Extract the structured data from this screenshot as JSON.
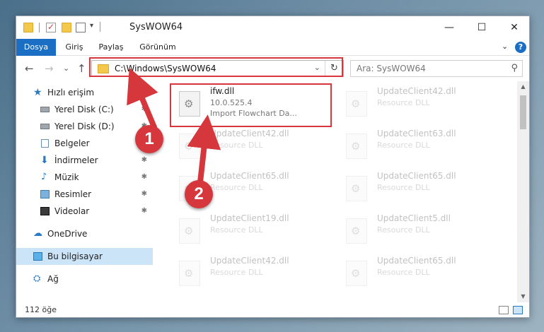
{
  "window": {
    "title": "SysWOW64",
    "minimize_glyph": "—",
    "maximize_glyph": "☐",
    "close_glyph": "✕"
  },
  "ribbon": {
    "tabs": [
      "Dosya",
      "Giriş",
      "Paylaş",
      "Görünüm"
    ],
    "expand_glyph": "⌄",
    "help_glyph": "?"
  },
  "nav": {
    "back_glyph": "←",
    "forward_glyph": "→",
    "recent_glyph": "⌄",
    "up_glyph": "↑",
    "address": "C:\\Windows\\SysWOW64",
    "refresh_glyph": "↻",
    "search_placeholder": "Ara: SysWOW64",
    "search_icon_glyph": "⚲"
  },
  "sidebar": {
    "items": [
      {
        "label": "Hızlı erişim",
        "icon": "star-icon",
        "glyph": "★",
        "pinned": false
      },
      {
        "label": "Yerel Disk (C:)",
        "icon": "disk-icon",
        "glyph": "",
        "pinned": true
      },
      {
        "label": "Yerel Disk (D:)",
        "icon": "disk-icon",
        "glyph": "",
        "pinned": true
      },
      {
        "label": "Belgeler",
        "icon": "documents-icon",
        "glyph": "",
        "pinned": true
      },
      {
        "label": "İndirmeler",
        "icon": "download-icon",
        "glyph": "⬇",
        "pinned": true
      },
      {
        "label": "Müzik",
        "icon": "music-icon",
        "glyph": "♪",
        "pinned": true
      },
      {
        "label": "Resimler",
        "icon": "pictures-icon",
        "glyph": "",
        "pinned": true
      },
      {
        "label": "Videolar",
        "icon": "videos-icon",
        "glyph": "",
        "pinned": true
      },
      {
        "label": "OneDrive",
        "icon": "onedrive-icon",
        "glyph": "☁",
        "pinned": false
      },
      {
        "label": "Bu bilgisayar",
        "icon": "this-pc-icon",
        "glyph": "",
        "pinned": false
      },
      {
        "label": "Ağ",
        "icon": "network-icon",
        "glyph": "⛭",
        "pinned": false
      }
    ],
    "pin_glyph": "✱"
  },
  "files": [
    {
      "name": "ifw.dll",
      "version": "10.0.525.4",
      "desc": "Import Flowchart Da..."
    },
    {
      "name": "UpdateClient42.dll",
      "version": "Resource DLL",
      "desc": ""
    },
    {
      "name": "UpdateClient42.dll",
      "version": "Resource DLL",
      "desc": ""
    },
    {
      "name": "UpdateClient63.dll",
      "version": "Resource DLL",
      "desc": ""
    },
    {
      "name": "UpdateClient65.dll",
      "version": "Resource DLL",
      "desc": ""
    },
    {
      "name": "UpdateClient65.dll",
      "version": "Resource DLL",
      "desc": ""
    },
    {
      "name": "UpdateClient19.dll",
      "version": "Resource DLL",
      "desc": ""
    },
    {
      "name": "UpdateClient5.dll",
      "version": "Resource DLL",
      "desc": ""
    },
    {
      "name": "UpdateClient42.dll",
      "version": "Resource DLL",
      "desc": ""
    },
    {
      "name": "UpdateClient65.dll",
      "version": "Resource DLL",
      "desc": ""
    }
  ],
  "status": {
    "count": "112 öğe"
  },
  "callouts": [
    "1",
    "2"
  ],
  "colors": {
    "accent": "#1a6fc4",
    "highlight_red": "#d6373c",
    "selection": "#cce4f7"
  }
}
